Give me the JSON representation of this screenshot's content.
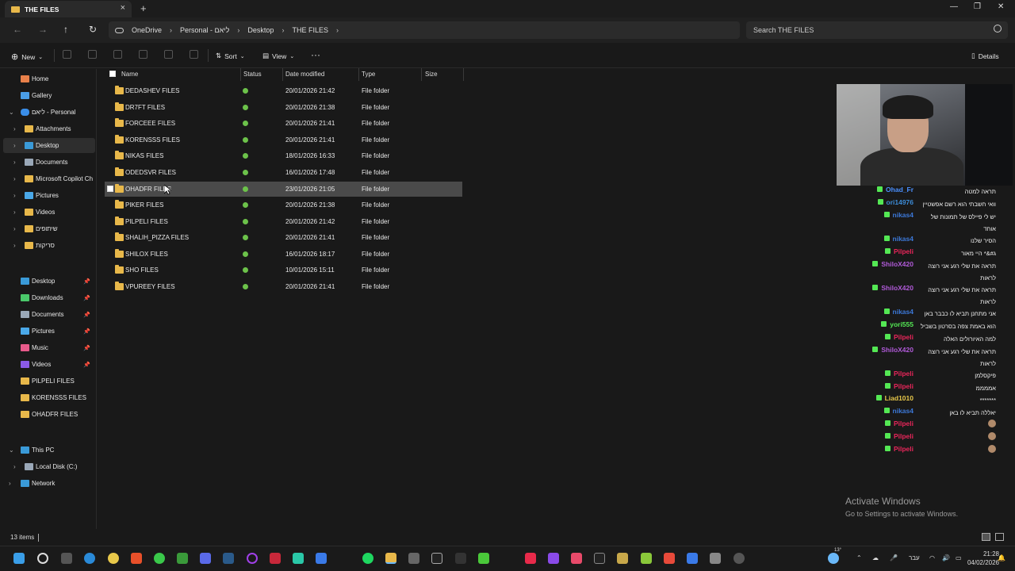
{
  "window": {
    "tab_title": "THE FILES",
    "close_glyph": "×",
    "newtab_glyph": "+",
    "minimize_glyph": "—",
    "maximize_glyph": "❐",
    "winclose_glyph": "✕"
  },
  "nav": {
    "back": "←",
    "forward": "→",
    "up": "↑",
    "refresh": "↻",
    "breadcrumbs": [
      "OneDrive",
      "Personal - ליאם",
      "Desktop",
      "THE FILES"
    ],
    "crumb_sep": "›",
    "search_placeholder": "Search THE FILES"
  },
  "toolbar": {
    "new_label": "New",
    "sort_label": "Sort",
    "view_label": "View",
    "more_label": "···",
    "details_label": "Details"
  },
  "sidebar": {
    "home": "Home",
    "gallery": "Gallery",
    "onedrive": "ליאם - Personal",
    "attachments": "Attachments",
    "desktop": "Desktop",
    "documents": "Documents",
    "copilot": "Microsoft Copilot Ch",
    "pictures": "Pictures",
    "videos": "Videos",
    "shared": "שיתופים",
    "scans": "סריקות",
    "quick": [
      {
        "label": "Desktop"
      },
      {
        "label": "Downloads"
      },
      {
        "label": "Documents"
      },
      {
        "label": "Pictures"
      },
      {
        "label": "Music"
      },
      {
        "label": "Videos"
      },
      {
        "label": "PILPELI FILES"
      },
      {
        "label": "KORENSSS FILES"
      },
      {
        "label": "OHADFR FILES"
      }
    ],
    "thispc": "This PC",
    "localdisk": "Local Disk (C:)",
    "network": "Network"
  },
  "columns": {
    "name": "Name",
    "status": "Status",
    "date": "Date modified",
    "type": "Type",
    "size": "Size"
  },
  "files": [
    {
      "name": "DEDASHEV FILES",
      "date": "20/01/2026 21:42",
      "type": "File folder"
    },
    {
      "name": "DR7FT FILES",
      "date": "20/01/2026 21:38",
      "type": "File folder"
    },
    {
      "name": "FORCEEE FILES",
      "date": "20/01/2026 21:41",
      "type": "File folder"
    },
    {
      "name": "KORENSSS FILES",
      "date": "20/01/2026 21:41",
      "type": "File folder"
    },
    {
      "name": "NIKAS FILES",
      "date": "18/01/2026 16:33",
      "type": "File folder"
    },
    {
      "name": "ODEDSVR FILES",
      "date": "16/01/2026 17:48",
      "type": "File folder"
    },
    {
      "name": "OHADFR FILES",
      "date": "23/01/2026 21:05",
      "type": "File folder"
    },
    {
      "name": "PIKER FILES",
      "date": "20/01/2026 21:38",
      "type": "File folder"
    },
    {
      "name": "PILPELI FILES",
      "date": "20/01/2026 21:42",
      "type": "File folder"
    },
    {
      "name": "SHALIH_PIZZA FILES",
      "date": "20/01/2026 21:41",
      "type": "File folder"
    },
    {
      "name": "SHILOX FILES",
      "date": "16/01/2026 18:17",
      "type": "File folder"
    },
    {
      "name": "SHO FILES",
      "date": "10/01/2026 15:11",
      "type": "File folder"
    },
    {
      "name": "VPUREEY FILES",
      "date": "20/01/2026 21:41",
      "type": "File folder"
    }
  ],
  "status": {
    "items": "13 items"
  },
  "chat": [
    {
      "user": "Ohad_Fr",
      "color": "#4a90ff",
      "text": "תראה למטה"
    },
    {
      "user": "ori14976",
      "color": "#3c8cd8",
      "text": "וואי חשבתי הוא רשם אפשטיין"
    },
    {
      "user": "nikas4",
      "color": "#3c78d8",
      "text": "יש לי פיילס של תמונות של אוחד"
    },
    {
      "user": "nikas4",
      "color": "#3c78d8",
      "text": "הסיר שלנו"
    },
    {
      "user": "Pilpeli",
      "color": "#e8265a",
      "text": "ג#&* היי מאור"
    },
    {
      "user": "ShiloX420",
      "color": "#b05ad8",
      "text": "תראה את שלי רגע אני רוצה לראות"
    },
    {
      "user": "ShiloX420",
      "color": "#b05ad8",
      "text": "תראה את שלי רגע אני רוצה לראות"
    },
    {
      "user": "nikas4",
      "color": "#3c78d8",
      "text": "אני מתחנן תביא לו כבבר באן"
    },
    {
      "user": "yori555",
      "color": "#54e854",
      "text": "הוא באמת צפה בסרטון בשביל"
    },
    {
      "user": "Pilpeli",
      "color": "#e8265a",
      "text": "למה האיורולים האלה"
    },
    {
      "user": "ShiloX420",
      "color": "#b05ad8",
      "text": "תראה את שלי רגע אני רוצה לראות"
    },
    {
      "user": "Pilpeli",
      "color": "#e8265a",
      "text": "פיקסלמן"
    },
    {
      "user": "Pilpeli",
      "color": "#e8265a",
      "text": "אממממ"
    },
    {
      "user": "Liad1010",
      "color": "#e8c84a",
      "text": "*******"
    },
    {
      "user": "nikas4",
      "color": "#3c78d8",
      "text": "יאללה תביא לו באן"
    },
    {
      "user": "Pilpeli",
      "color": "#e8265a",
      "text": ""
    },
    {
      "user": "Pilpeli",
      "color": "#e8265a",
      "text": ""
    },
    {
      "user": "Pilpeli",
      "color": "#e8265a",
      "text": ""
    }
  ],
  "activation": {
    "title": "Activate Windows",
    "subtitle": "Go to Settings to activate Windows."
  },
  "taskbar": {
    "time": "21:28",
    "date": "04/02/2026",
    "lang": "עבר",
    "weather_temp": "13°"
  }
}
